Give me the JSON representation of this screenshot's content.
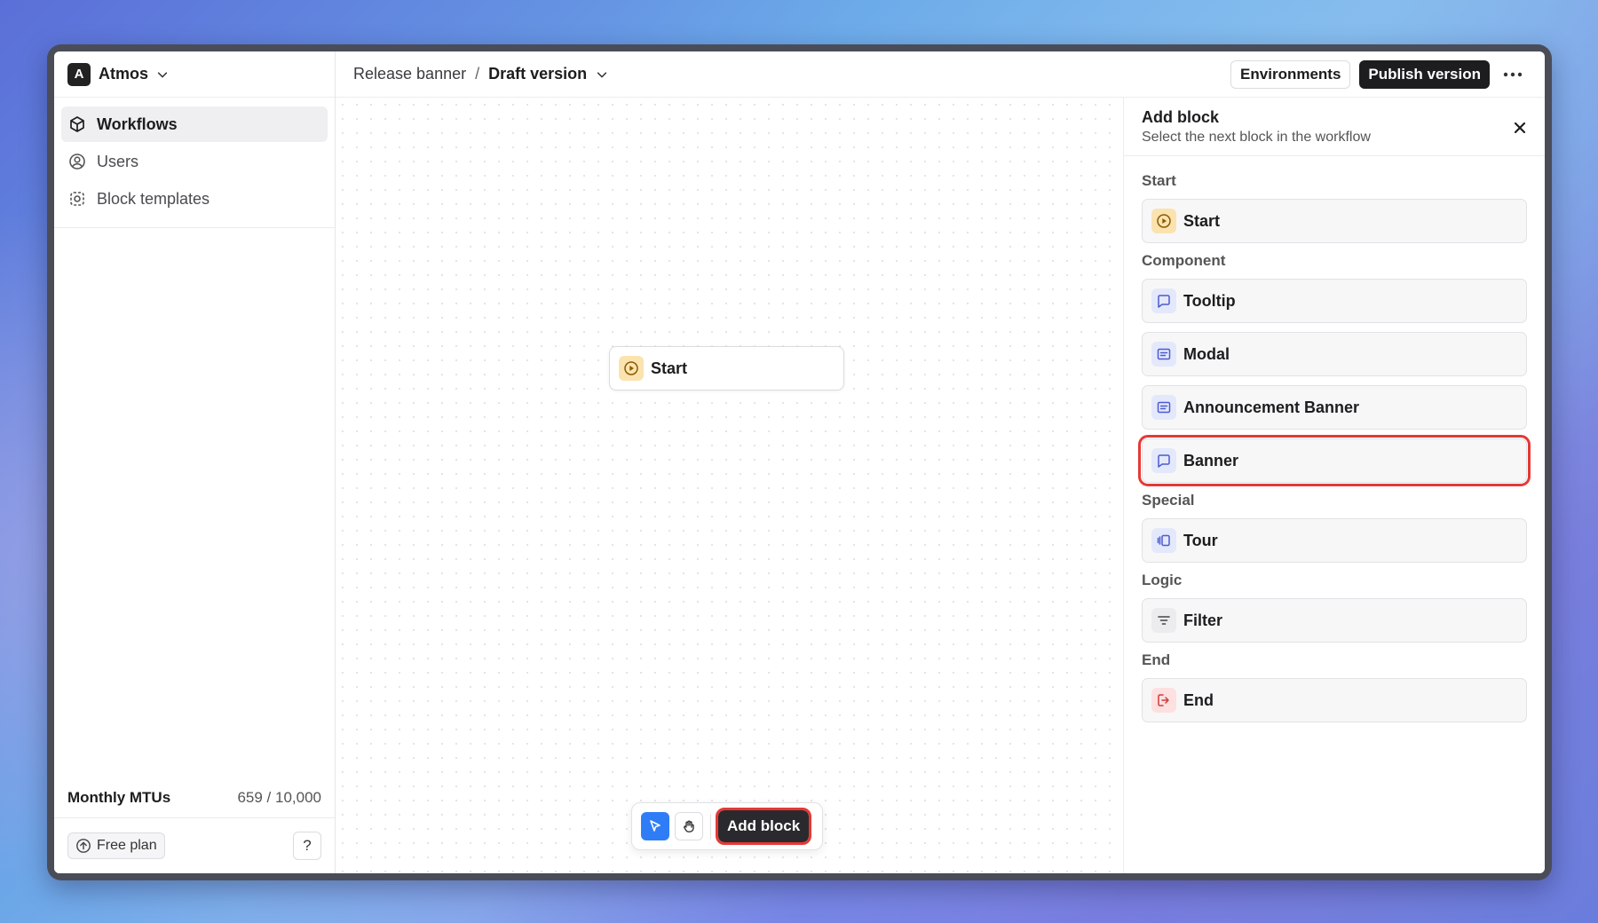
{
  "org": {
    "badge": "A",
    "name": "Atmos"
  },
  "sidebar": {
    "items": [
      {
        "label": "Workflows",
        "icon": "cube-icon",
        "active": true
      },
      {
        "label": "Users",
        "icon": "user-circle-icon"
      },
      {
        "label": "Block templates",
        "icon": "template-icon"
      }
    ],
    "mtus_label": "Monthly MTUs",
    "mtus_value": "659 / 10,000",
    "plan_label": "Free plan",
    "help_label": "?"
  },
  "header": {
    "breadcrumb_1": "Release banner",
    "separator": "/",
    "breadcrumb_2": "Draft version",
    "environments_label": "Environments",
    "publish_label": "Publish version"
  },
  "canvas": {
    "node_label": "Start",
    "add_block_label": "Add block"
  },
  "panel": {
    "title": "Add block",
    "subtitle": "Select the next block in the workflow",
    "sections": [
      {
        "label": "Start",
        "blocks": [
          "Start"
        ]
      },
      {
        "label": "Component",
        "blocks": [
          "Tooltip",
          "Modal",
          "Announcement Banner",
          "Banner"
        ]
      },
      {
        "label": "Special",
        "blocks": [
          "Tour"
        ]
      },
      {
        "label": "Logic",
        "blocks": [
          "Filter"
        ]
      },
      {
        "label": "End",
        "blocks": [
          "End"
        ]
      }
    ]
  },
  "colors": {
    "accent": "#2f7df6",
    "highlight": "#e53935",
    "dark": "#1d1d1f"
  }
}
